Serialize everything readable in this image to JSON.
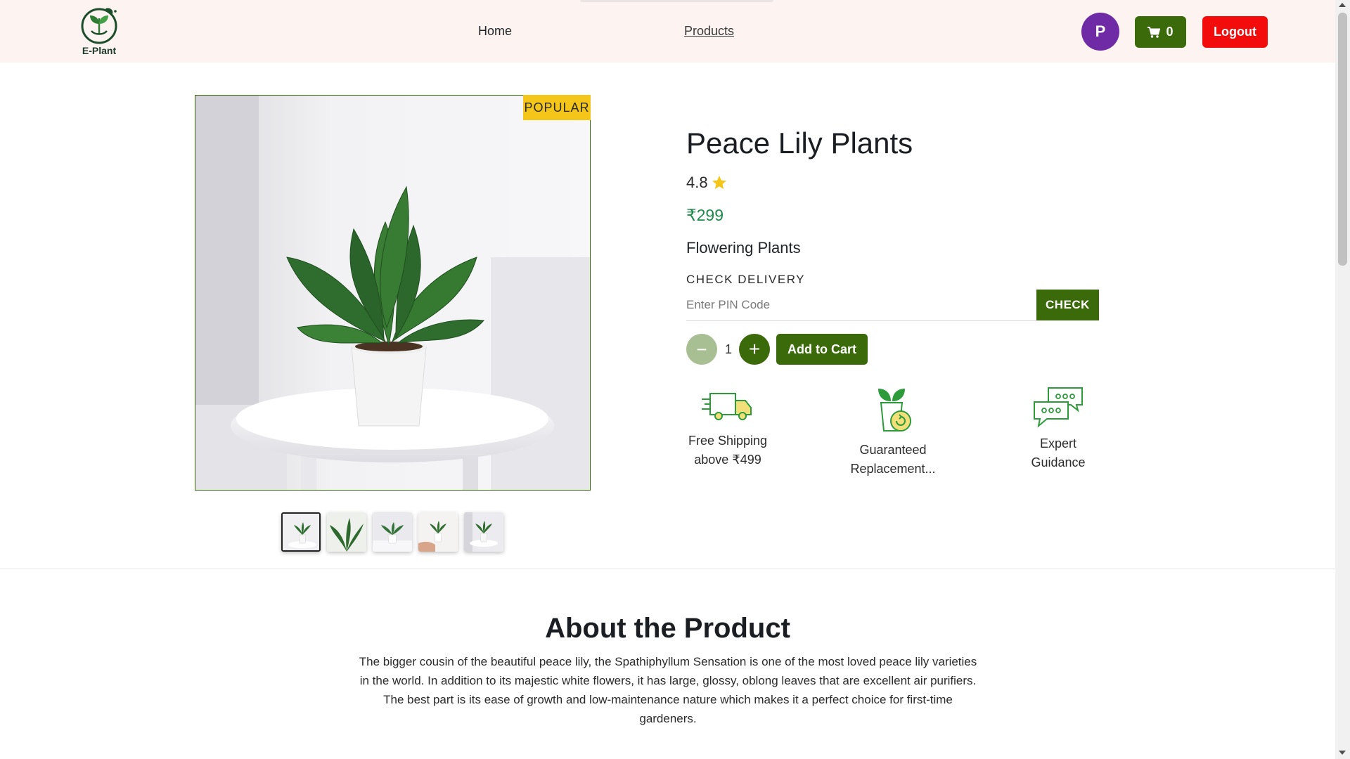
{
  "brand": {
    "logo_text": "E-Plant"
  },
  "nav": {
    "home": "Home",
    "products": "Products"
  },
  "user": {
    "avatar_initial": "P"
  },
  "cart": {
    "count": "0"
  },
  "auth": {
    "logout_label": "Logout"
  },
  "product": {
    "badge": "POPULAR",
    "title": "Peace Lily Plants",
    "rating": "4.8",
    "price": "₹299",
    "category": "Flowering Plants",
    "delivery_label": "CHECK DELIVERY",
    "pin_placeholder": "Enter PIN Code",
    "check_label": "CHECK",
    "quantity": "1",
    "minus": "−",
    "plus": "+",
    "add_to_cart": "Add to Cart",
    "thumbnail_count": 5
  },
  "features": [
    {
      "icon": "delivery-truck-icon",
      "line1": "Free Shipping",
      "line2": "above ₹499"
    },
    {
      "icon": "plant-replacement-icon",
      "line1": "Guaranteed",
      "line2": "Replacement..."
    },
    {
      "icon": "chat-bubbles-icon",
      "line1": "Expert",
      "line2": "Guidance"
    }
  ],
  "about": {
    "title": "About the Product",
    "text": "The bigger cousin of the beautiful peace lily, the Spathiphyllum Sensation is one of the most loved peace lily varieties in the world. In addition to its majestic white flowers, it has large, glossy, oblong leaves that are excellent air purifiers. The best part is its ease of growth and low-maintenance nature which makes it a perfect choice for first-time gardeners."
  },
  "colors": {
    "header_bg": "#fdf4f2",
    "primary_green": "#3b6a0a",
    "logout_red": "#f20c0c",
    "avatar_purple": "#6f2aa5",
    "price_green": "#1f8a4c",
    "badge_yellow": "#f5c61a",
    "star": "#f5c61a"
  }
}
